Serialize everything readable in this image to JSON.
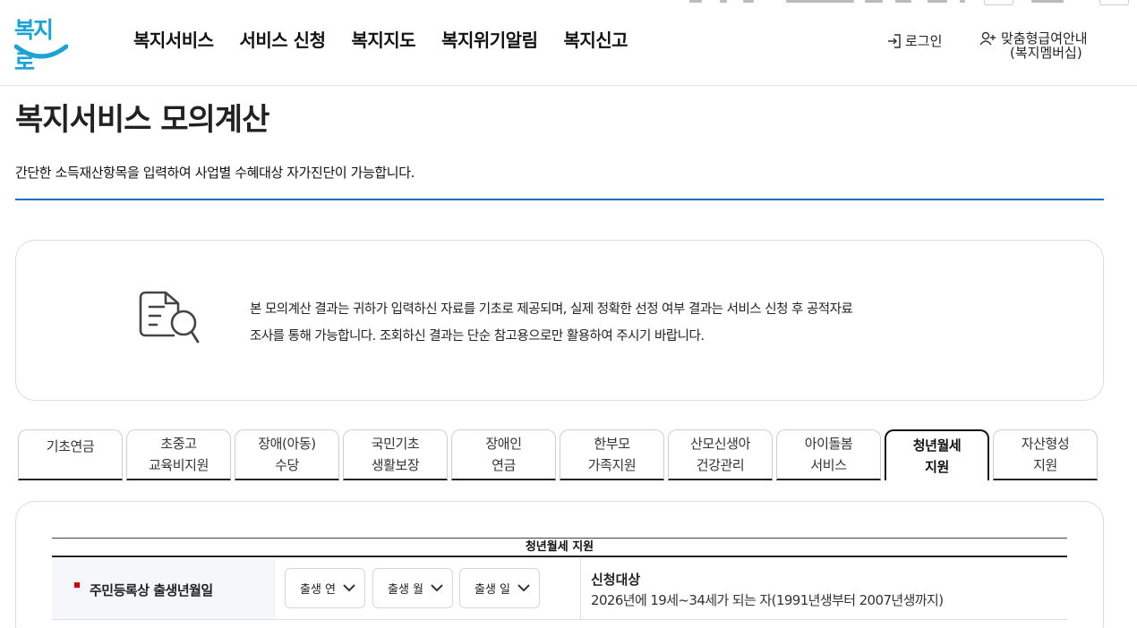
{
  "brand": {
    "logo_text": "복지로",
    "accent": "#1aa3d4"
  },
  "nav": {
    "items": [
      "복지서비스",
      "서비스 신청",
      "복지지도",
      "복지위기알림",
      "복지신고"
    ]
  },
  "util": {
    "login": "로그인",
    "member_line1": "맞춤형급여안내",
    "member_line2": "(복지멤버십)"
  },
  "page": {
    "title": "복지서비스 모의계산",
    "desc": "간단한 소득재산항목을 입력하여 사업별 수혜대상 자가진단이 가능합니다.",
    "rule_color": "#1f6fbf"
  },
  "notice": {
    "line1": "본 모의계산 결과는 귀하가 입력하신 자료를 기초로 제공되며, 실제 정확한 선정 여부 결과는 서비스 신청 후 공적자료",
    "line2": "조사를 통해 가능합니다. 조회하신 결과는 단순 참고용으로만 활용하여 주시기 바랍니다."
  },
  "tabs": [
    {
      "line1": "기초연금",
      "line2": ""
    },
    {
      "line1": "초중고",
      "line2": "교육비지원"
    },
    {
      "line1": "장애(아동)",
      "line2": "수당"
    },
    {
      "line1": "국민기초",
      "line2": "생활보장"
    },
    {
      "line1": "장애인",
      "line2": "연금"
    },
    {
      "line1": "한부모",
      "line2": "가족지원"
    },
    {
      "line1": "산모신생아",
      "line2": "건강관리"
    },
    {
      "line1": "아이돌봄",
      "line2": "서비스"
    },
    {
      "line1": "청년월세",
      "line2": "지원"
    },
    {
      "line1": "자산형성",
      "line2": "지원"
    }
  ],
  "active_tab": "청년월세 지원",
  "form": {
    "table_title": "청년월세 지원",
    "birth_label": "주민등록상 출생년월일",
    "selects": {
      "year": "출생 연",
      "month": "출생 월",
      "day": "출생 일"
    },
    "info_title": "신청대상",
    "info_text": "2026년에 19세~34세가 되는 자(1991년생부터 2007년생까지)",
    "required_color": "#d40000"
  }
}
